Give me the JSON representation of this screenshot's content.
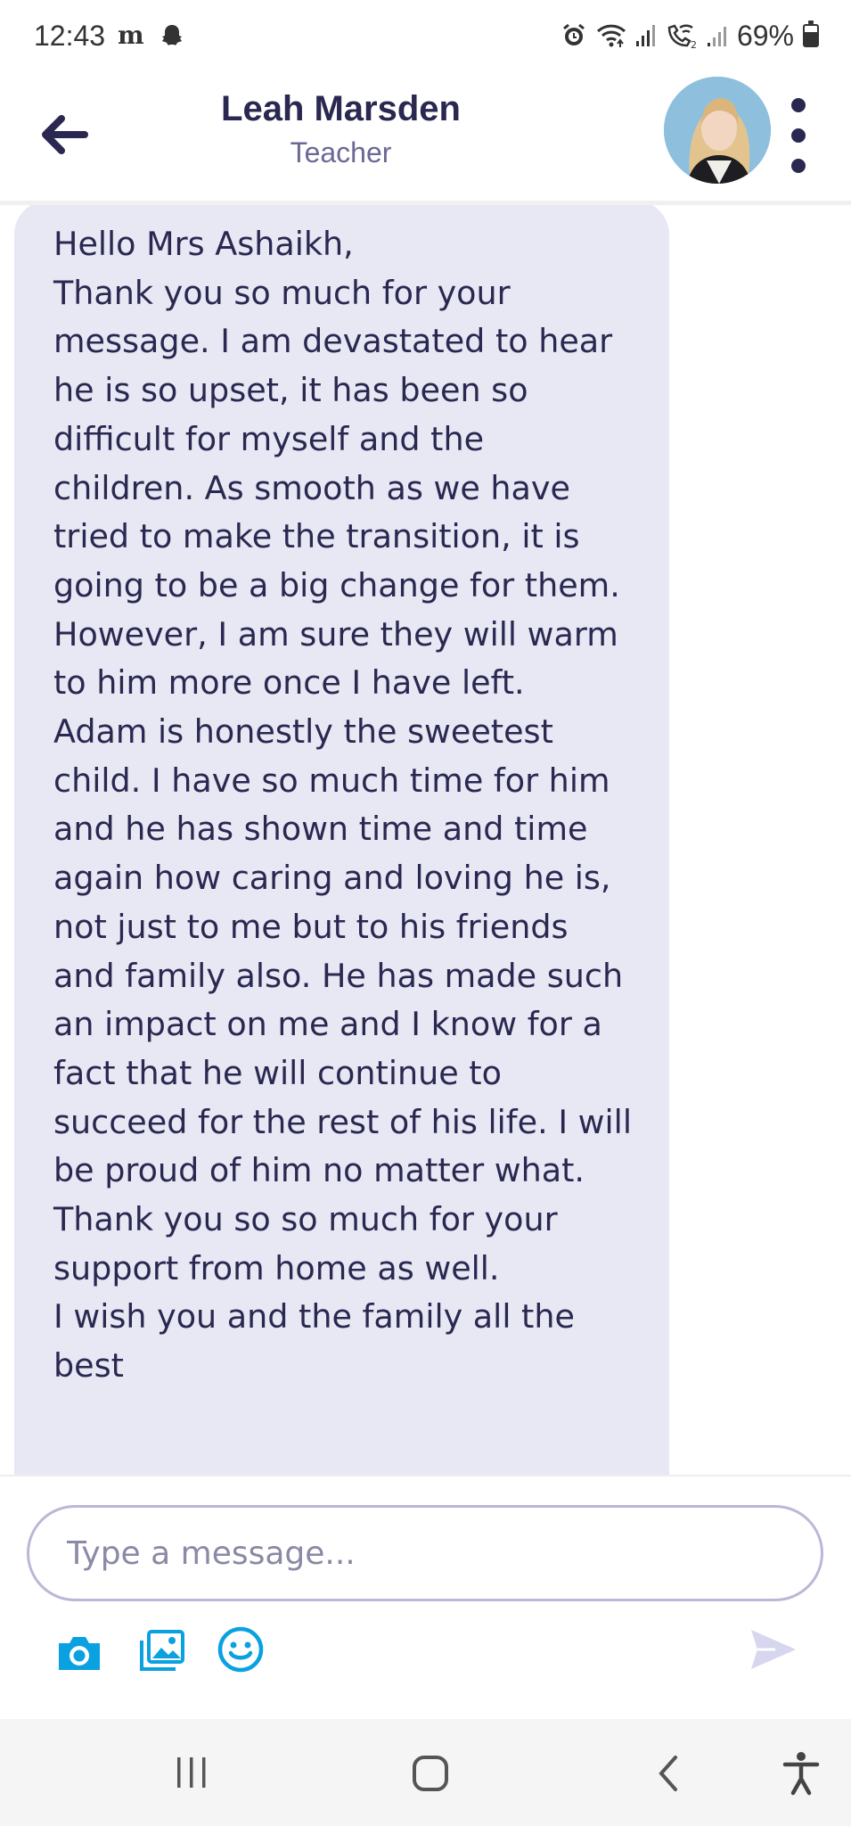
{
  "status_bar": {
    "time": "12:43",
    "battery": "69%",
    "battery_level": 0.69,
    "icons": [
      "m-app-icon",
      "snapchat-icon",
      "alarm-icon",
      "wifi-icon",
      "signal-icon",
      "wifi-calling-icon",
      "signal-icon-2",
      "battery-icon"
    ]
  },
  "header": {
    "name": "Leah Marsden",
    "role": "Teacher",
    "back_icon": "arrow-left-icon",
    "menu_icon": "more-vertical-icon"
  },
  "message": {
    "text": "Hello Mrs Ashaikh,\nThank you so much for your message. I am devastated to hear he is so upset, it has been so difficult for myself and the children. As smooth as we have tried to make the transition, it is going to be a big change for them. However, I am sure they will warm to him more once I have left.\nAdam is honestly the sweetest child. I have so much time for him and he has shown time and time again how caring and loving he is, not just to me but to his friends and family also. He has made such an impact on me and I know for a fact that he will continue to succeed for the rest of his life. I will be proud of him no matter what. Thank you so so much for your support from home as well.\nI wish you and the family all the best"
  },
  "composer": {
    "placeholder": "Type a message...",
    "value": "",
    "tools": [
      "camera-icon",
      "gallery-icon",
      "emoji-icon"
    ],
    "send_icon": "send-icon"
  },
  "nav": {
    "items": [
      "recent-apps-icon",
      "home-icon",
      "back-icon",
      "accessibility-icon"
    ]
  },
  "colors": {
    "accent": "#0aa1e0",
    "text_primary": "#2a2850",
    "bubble_bg": "#e7e8f4",
    "send_disabled": "#d6d6ee"
  }
}
